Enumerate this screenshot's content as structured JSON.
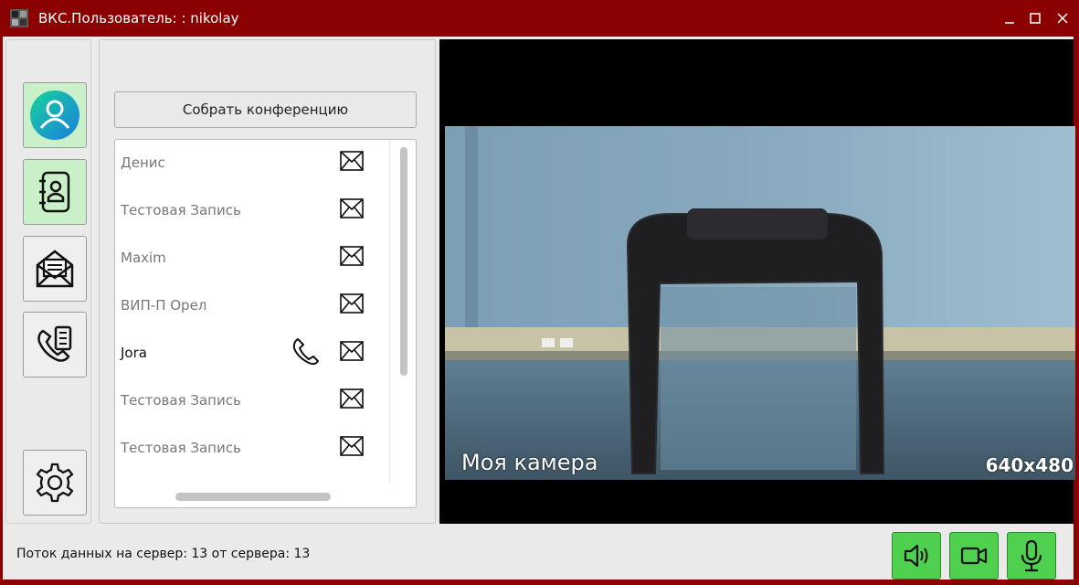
{
  "window": {
    "title": "ВКС.Пользователь: : nikolay",
    "controls": [
      "minimize-icon",
      "maximize-icon",
      "close-icon"
    ]
  },
  "nav": {
    "items": [
      {
        "icon": "user-profile-icon",
        "active": true
      },
      {
        "icon": "address-book-icon",
        "active": true
      },
      {
        "icon": "envelope-open-icon",
        "active": false
      },
      {
        "icon": "call-log-icon",
        "active": false
      },
      {
        "icon": "gear-icon",
        "active": false
      }
    ]
  },
  "contacts": {
    "conference_button": "Собрать конференцию",
    "items": [
      {
        "name": "Денис",
        "online": false
      },
      {
        "name": "Тестовая Запись",
        "online": false
      },
      {
        "name": "Maxim",
        "online": false
      },
      {
        "name": "ВИП-П Орел",
        "online": false
      },
      {
        "name": "Jora",
        "online": true
      },
      {
        "name": "Тестовая Запись",
        "online": false
      },
      {
        "name": "Тестовая Запись",
        "online": false
      }
    ]
  },
  "video": {
    "label": "Моя камера",
    "resolution": "640x480"
  },
  "status": {
    "text": "Поток данных на сервер: 13 от сервера: 13"
  },
  "controls": {
    "buttons": [
      "speaker-icon",
      "camera-icon",
      "microphone-icon"
    ],
    "color": "#4fd04f"
  },
  "theme": {
    "titlebar": "#8b0000",
    "accent": "#00c9a7"
  }
}
